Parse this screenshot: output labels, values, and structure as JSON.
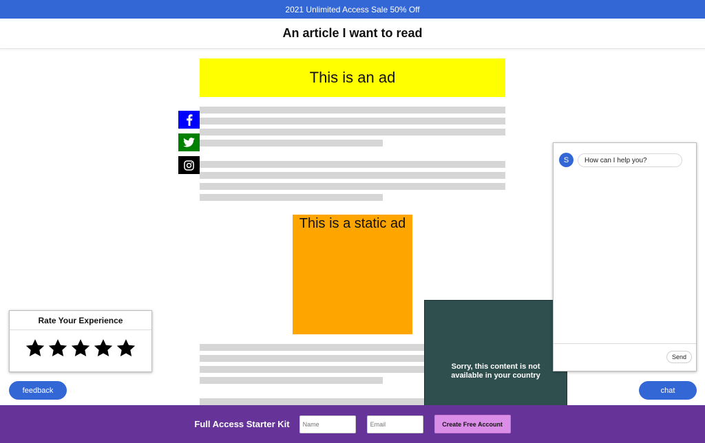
{
  "topbar": {
    "text": "2021 Unlimited Access Sale 50% Off"
  },
  "header": {
    "title": "An article I want to read"
  },
  "ads": {
    "banner": "This is an ad",
    "static": "This is a static ad"
  },
  "social": {
    "facebook_icon": "facebook-icon",
    "twitter_icon": "twitter-icon",
    "instagram_icon": "instagram-icon"
  },
  "geo_block": {
    "line1": "Sorry, this content is not",
    "line2": "available in your country"
  },
  "chat_widget": {
    "avatar_letter": "S",
    "message": "How can I help you?",
    "send_label": "Send"
  },
  "rating": {
    "title": "Rate Your Experience",
    "star_count": 5
  },
  "buttons": {
    "feedback": "feedback",
    "chat": "chat"
  },
  "footer": {
    "label": "Full Access Starter Kit",
    "name_placeholder": "Name",
    "email_placeholder": "Email",
    "cta": "Create Free Account"
  },
  "colors": {
    "brand_blue": "#3467d6",
    "footer_purple": "#663399",
    "cta_pink": "#da8ee7",
    "ad_yellow": "#ffff00",
    "ad_orange": "#ffa500"
  }
}
